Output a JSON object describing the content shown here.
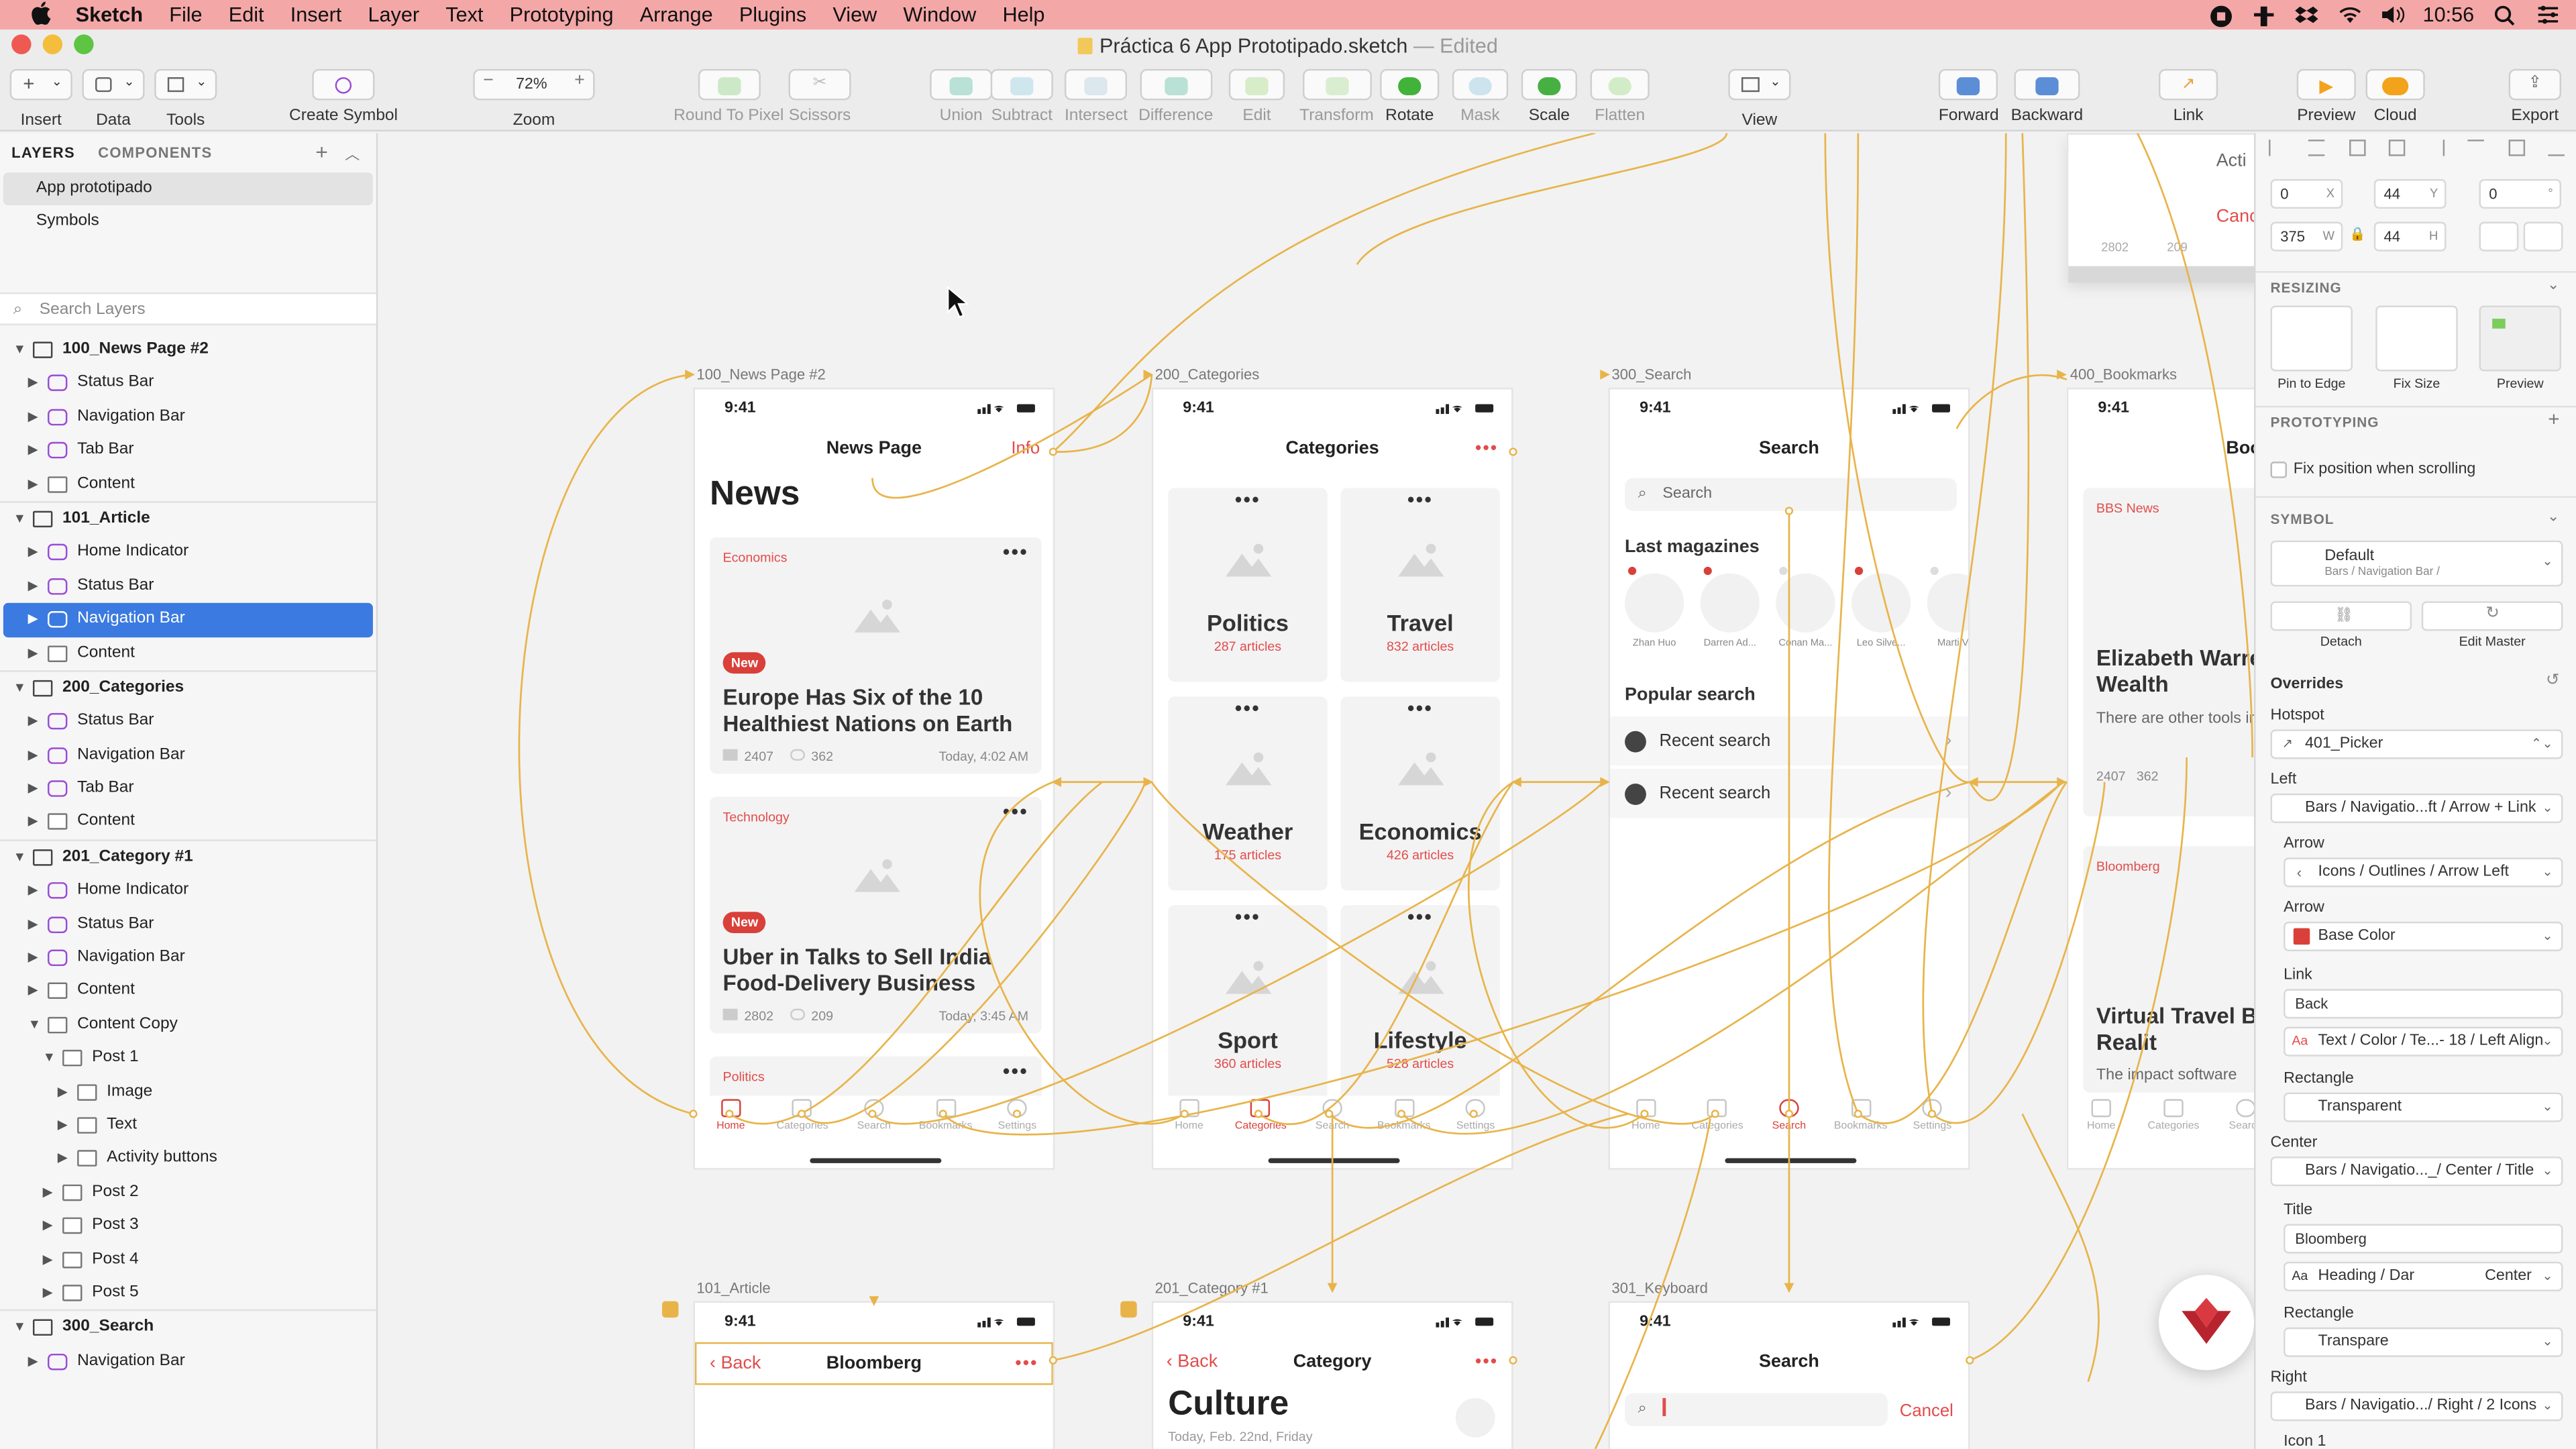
{
  "menubar": {
    "app": "Sketch",
    "items": [
      "File",
      "Edit",
      "Insert",
      "Layer",
      "Text",
      "Prototyping",
      "Arrange",
      "Plugins",
      "View",
      "Window",
      "Help"
    ],
    "clock": "10:56"
  },
  "window": {
    "title": "Práctica 6 App Prototipado.sketch",
    "edited": "— Edited"
  },
  "toolbar": {
    "insert": "Insert",
    "data": "Data",
    "tools": "Tools",
    "create_symbol": "Create Symbol",
    "zoom_value": "72%",
    "zoom": "Zoom",
    "round_to_pixel": "Round To Pixel",
    "scissors": "Scissors",
    "union": "Union",
    "subtract": "Subtract",
    "intersect": "Intersect",
    "difference": "Difference",
    "edit": "Edit",
    "transform": "Transform",
    "rotate": "Rotate",
    "mask": "Mask",
    "scale": "Scale",
    "flatten": "Flatten",
    "view": "View",
    "forward": "Forward",
    "backward": "Backward",
    "link": "Link",
    "preview": "Preview",
    "cloud": "Cloud",
    "export": "Export"
  },
  "left_panel": {
    "tab_layers": "LAYERS",
    "tab_components": "COMPONENTS",
    "pages": [
      "App prototipado",
      "Symbols"
    ],
    "search_placeholder": "Search Layers",
    "layers": [
      {
        "name": "100_News Page #2",
        "type": "artboard",
        "depth": 0,
        "open": true
      },
      {
        "name": "Status Bar",
        "type": "symbol",
        "depth": 1
      },
      {
        "name": "Navigation Bar",
        "type": "symbol",
        "depth": 1
      },
      {
        "name": "Tab Bar",
        "type": "symbol",
        "depth": 1
      },
      {
        "name": "Content",
        "type": "group",
        "depth": 1
      },
      {
        "name": "101_Article",
        "type": "artboard",
        "depth": 0,
        "open": true
      },
      {
        "name": "Home Indicator",
        "type": "symbol",
        "depth": 1
      },
      {
        "name": "Status Bar",
        "type": "symbol",
        "depth": 1
      },
      {
        "name": "Navigation Bar",
        "type": "symbol",
        "depth": 1,
        "selected": true
      },
      {
        "name": "Content",
        "type": "folder",
        "depth": 1
      },
      {
        "name": "200_Categories",
        "type": "artboard",
        "depth": 0,
        "open": true
      },
      {
        "name": "Status Bar",
        "type": "symbol",
        "depth": 1
      },
      {
        "name": "Navigation Bar",
        "type": "symbol",
        "depth": 1
      },
      {
        "name": "Tab Bar",
        "type": "symbol",
        "depth": 1
      },
      {
        "name": "Content",
        "type": "group",
        "depth": 1
      },
      {
        "name": "201_Category #1",
        "type": "artboard",
        "depth": 0,
        "open": true
      },
      {
        "name": "Home Indicator",
        "type": "symbol",
        "depth": 1
      },
      {
        "name": "Status Bar",
        "type": "symbol",
        "depth": 1
      },
      {
        "name": "Navigation Bar",
        "type": "symbol",
        "depth": 1
      },
      {
        "name": "Content",
        "type": "folder",
        "depth": 1
      },
      {
        "name": "Content Copy",
        "type": "folder",
        "depth": 1,
        "open": true
      },
      {
        "name": "Post 1",
        "type": "folder",
        "depth": 2,
        "open": true
      },
      {
        "name": "Image",
        "type": "folder",
        "depth": 3
      },
      {
        "name": "Text",
        "type": "folder",
        "depth": 3
      },
      {
        "name": "Activity buttons",
        "type": "folder",
        "depth": 3
      },
      {
        "name": "Post 2",
        "type": "folder",
        "depth": 2
      },
      {
        "name": "Post 3",
        "type": "folder",
        "depth": 2
      },
      {
        "name": "Post 4",
        "type": "folder",
        "depth": 2
      },
      {
        "name": "Post 5",
        "type": "folder",
        "depth": 2
      },
      {
        "name": "300_Search",
        "type": "artboard",
        "depth": 0,
        "open": true
      },
      {
        "name": "Navigation Bar",
        "type": "symbol",
        "depth": 1
      }
    ]
  },
  "canvas": {
    "time": "9:41",
    "artboards": {
      "news": {
        "label": "100_News Page #2",
        "nav_title": "News Page",
        "nav_action": "Info",
        "big_title": "News",
        "cards": [
          {
            "tag": "Economics",
            "badge": "New",
            "headline": "Europe Has Six of the 10 Healthiest Nations on Earth",
            "comments": "2407",
            "views": "362",
            "time": "Today, 4:02 AM"
          },
          {
            "tag": "Technology",
            "badge": "New",
            "headline": "Uber in Talks to Sell India Food-Delivery Business",
            "comments": "2802",
            "views": "209",
            "time": "Today, 3:45 AM"
          },
          {
            "tag": "Politics"
          }
        ]
      },
      "categories": {
        "label": "200_Categories",
        "nav_title": "Categories",
        "items": [
          {
            "name": "Politics",
            "count": "287 articles"
          },
          {
            "name": "Travel",
            "count": "832 articles"
          },
          {
            "name": "Weather",
            "count": "175 articles"
          },
          {
            "name": "Economics",
            "count": "426 articles"
          },
          {
            "name": "Sport",
            "count": "360 articles"
          },
          {
            "name": "Lifestyle",
            "count": "528 articles"
          }
        ]
      },
      "search": {
        "label": "300_Search",
        "nav_title": "Search",
        "search_placeholder": "Search",
        "last_magazines": "Last magazines",
        "magazines": [
          "Zhan Huo",
          "Darren Ad...",
          "Conan Ma...",
          "Leo Silve...",
          "Marti V..."
        ],
        "popular_search": "Popular search",
        "recent": [
          "Recent search",
          "Recent search"
        ]
      },
      "bookmarks": {
        "label": "400_Bookmarks",
        "nav_title": "Bookm",
        "tag1": "BBS News",
        "headline1": "Elizabeth Warre Wants a Wealth",
        "body1": "There are other tools involve quite the risks",
        "comments": "2407",
        "views": "362",
        "tag2": "Bloomberg",
        "headline2": "Virtual Travel B More of a Realit",
        "body2": "The impact software"
      },
      "article": {
        "label": "101_Article",
        "back": "Back",
        "nav_title": "Bloomberg"
      },
      "category1": {
        "label": "201_Category #1",
        "back": "Back",
        "nav_title": "Category",
        "big_title": "Culture",
        "date": "Today, Feb. 22nd, Friday"
      },
      "keyboard": {
        "label": "301_Keyboard",
        "nav_title": "Search",
        "cancel": "Cancel"
      },
      "action_sheet": {
        "action": "Acti",
        "cancel": "Canc",
        "meta": "2802",
        "meta2": "209"
      }
    },
    "tabs": [
      "Home",
      "Categories",
      "Search",
      "Bookmarks",
      "Settings"
    ]
  },
  "inspector": {
    "x": "0",
    "x_lbl": "X",
    "y": "44",
    "y_lbl": "Y",
    "rot": "0",
    "rot_lbl": "°",
    "w": "375",
    "w_lbl": "W",
    "h": "44",
    "h_lbl": "H",
    "resizing": "RESIZING",
    "pin_to_edge": "Pin to Edge",
    "fix_size": "Fix Size",
    "preview": "Preview",
    "prototyping": "PROTOTYPING",
    "fix_position": "Fix position when scrolling",
    "symbol": "SYMBOL",
    "symbol_name": "Default",
    "symbol_path": "Bars / Navigation Bar /",
    "detach": "Detach",
    "edit_master": "Edit Master",
    "overrides": "Overrides",
    "hotspot_lbl": "Hotspot",
    "hotspot": "401_Picker",
    "left_lbl": "Left",
    "left": "Bars / Navigatio...ft / Arrow + Link",
    "arrow_lbl": "Arrow",
    "arrow": "Icons / Outlines / Arrow Left",
    "arrow2_lbl": "Arrow",
    "arrow2": "Base Color",
    "link_lbl": "Link",
    "link": "Back",
    "link_style": "Text / Color / Te...- 18 / Left Align",
    "rect_lbl": "Rectangle",
    "rect": "Transparent",
    "center_lbl": "Center",
    "center": "Bars / Navigatio..._/ Center / Title",
    "title_lbl": "Title",
    "title": "Bloomberg",
    "title_style": "Heading / Dar",
    "title_style_end": "Center",
    "rect2_lbl": "Rectangle",
    "rect2": "Transpare",
    "right_lbl": "Right",
    "right": "Bars / Navigatio.../ Right / 2 Icons",
    "icon1_lbl": "Icon 1",
    "accent": "#d9403a",
    "link_color": "#e8b44a"
  }
}
